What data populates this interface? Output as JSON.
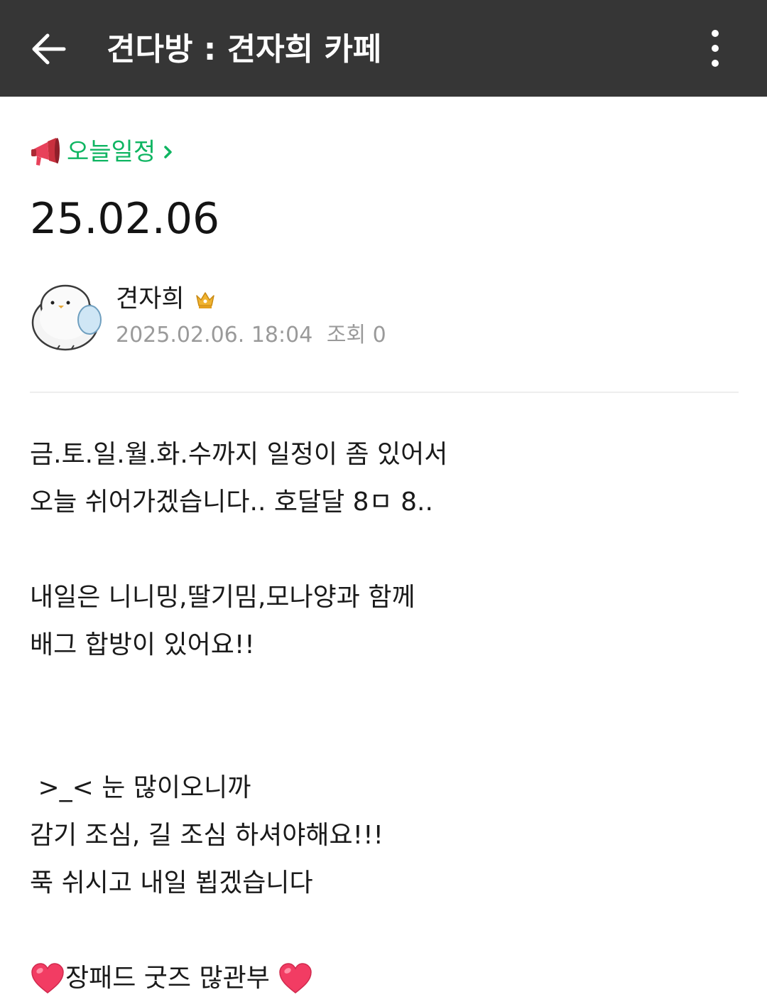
{
  "app_bar": {
    "title": "견다방 : 견자희 카페",
    "back_icon": "back-arrow-icon",
    "more_icon": "more-vertical-icon",
    "background": "#363636"
  },
  "board": {
    "name": "오늘일정",
    "icon": "megaphone-icon",
    "color": "#0fb562"
  },
  "post": {
    "title": "25.02.06",
    "author": {
      "name": "견자희",
      "badge_icon": "crown-icon"
    },
    "date": "2025.02.06. 18:04",
    "views": "조회 0",
    "content": {
      "lines": [
        "금.토.일.월.화.수까지 일정이 좀 있어서",
        "오늘 쉬어가겠습니다.. 호달달 8ㅁ 8..",
        "",
        "내일은 니니밍,딸기밈,모나양과 함께",
        "배그 합방이 있어요!!",
        "",
        "",
        " >_< 눈 많이오니까",
        "감기 조심, 길 조심 하셔야해요!!!",
        "푹 쉬시고 내일 뵙겠습니다",
        ""
      ],
      "closing": {
        "text": "장패드 굿즈 많관부 ",
        "icon": "heart-icon"
      }
    }
  }
}
